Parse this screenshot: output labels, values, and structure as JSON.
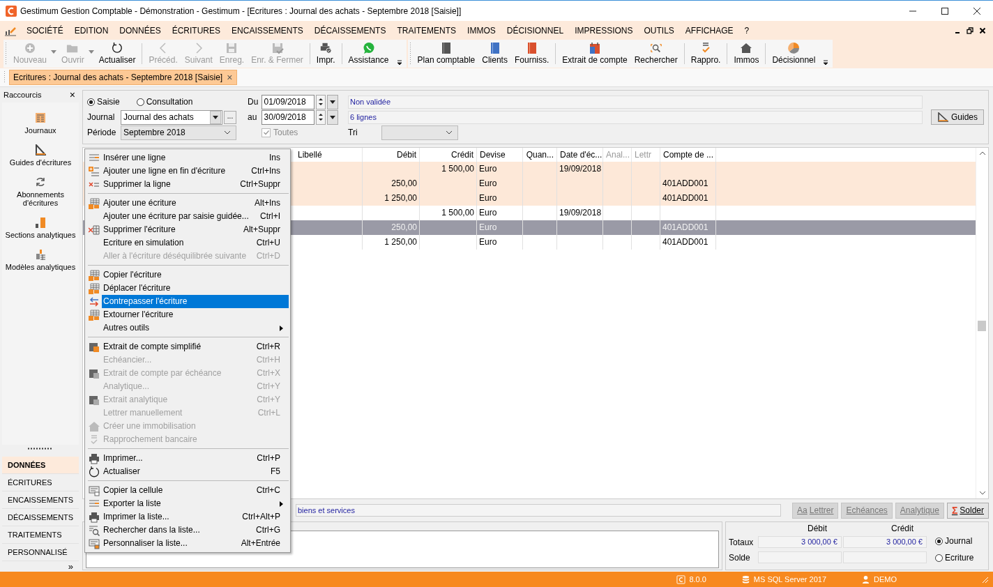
{
  "window": {
    "title": "Gestimum Gestion Comptable - Démonstration - Gestimum - [Ecritures : Journal des achats - Septembre 2018 [Saisie]]"
  },
  "menubar": {
    "items": [
      "SOCIÉTÉ",
      "EDITION",
      "DONNÉES",
      "ÉCRITURES",
      "ENCAISSEMENTS",
      "DÉCAISSEMENTS",
      "TRAITEMENTS",
      "IMMOS",
      "DÉCISIONNEL",
      "IMPRESSIONS",
      "OUTILS",
      "AFFICHAGE",
      "?"
    ]
  },
  "toolbars": [
    {
      "groups": [
        [
          {
            "label": "Nouveau",
            "disabled": true,
            "dropdown": true
          },
          {
            "label": "Ouvrir",
            "disabled": true,
            "dropdown": true
          },
          {
            "label": "Actualiser",
            "disabled": false,
            "dropdown": false
          }
        ],
        [
          {
            "label": "Précéd.",
            "disabled": true,
            "dropdown": false
          },
          {
            "label": "Suivant",
            "disabled": true,
            "dropdown": false
          },
          {
            "label": "Enreg.",
            "disabled": true,
            "dropdown": false
          },
          {
            "label": "Enr. & Fermer",
            "disabled": true,
            "dropdown": false
          }
        ],
        [
          {
            "label": "Impr.",
            "disabled": false,
            "dropdown": false
          }
        ],
        [
          {
            "label": "Assistance",
            "disabled": false,
            "dropdown": false
          }
        ]
      ]
    },
    {
      "groups": [
        [
          {
            "label": "Plan comptable",
            "disabled": false,
            "dropdown": false
          },
          {
            "label": "Clients",
            "disabled": false,
            "dropdown": false
          },
          {
            "label": "Fourniss.",
            "disabled": false,
            "dropdown": false
          }
        ],
        [
          {
            "label": "Extrait de compte",
            "disabled": false,
            "dropdown": false
          },
          {
            "label": "Rechercher",
            "disabled": false,
            "dropdown": false
          }
        ],
        [
          {
            "label": "Rappro.",
            "disabled": false,
            "dropdown": false
          }
        ],
        [
          {
            "label": "Immos",
            "disabled": false,
            "dropdown": false
          }
        ],
        [
          {
            "label": "Décisionnel",
            "disabled": false,
            "dropdown": false
          }
        ]
      ]
    }
  ],
  "document_tab": {
    "label": "Ecritures : Journal des achats - Septembre 2018 [Saisie]",
    "close": "×"
  },
  "sidebar": {
    "title": "Raccourcis",
    "close": "×",
    "shortcuts": [
      "Journaux",
      "Guides d'écritures",
      "Abonnements d'écritures",
      "Sections analytiques",
      "Modèles analytiques"
    ],
    "nav": [
      {
        "label": "DONNÉES",
        "selected": true
      },
      {
        "label": "ÉCRITURES",
        "selected": false
      },
      {
        "label": "ENCAISSEMENTS",
        "selected": false
      },
      {
        "label": "DÉCAISSEMENTS",
        "selected": false
      },
      {
        "label": "TRAITEMENTS",
        "selected": false
      },
      {
        "label": "PERSONNALISÉ",
        "selected": false
      }
    ],
    "more": "»"
  },
  "filter": {
    "modes": [
      {
        "label": "Saisie",
        "selected": true
      },
      {
        "label": "Consultation",
        "selected": false
      }
    ],
    "journal_label": "Journal",
    "journal": "Journal des achats",
    "journal_browse": "...",
    "periode_label": "Période",
    "periode": "Septembre 2018",
    "du_label": "Du",
    "du": "01/09/2018",
    "au_label": "au",
    "au": "30/09/2018",
    "toutes": {
      "label": "Toutes",
      "checked": true,
      "disabled": true
    },
    "status": "Non validée",
    "count": "6 lignes",
    "tri_label": "Tri",
    "guides": "Guides"
  },
  "table": {
    "columns": [
      "Libellé",
      "Débit",
      "Crédit",
      "Devise",
      "Quan...",
      "Date d'éc...",
      "Anal...",
      "Lettr",
      "Compte de ..."
    ],
    "rows": [
      {
        "current_entry": true,
        "selected": false,
        "cells": [
          "",
          "",
          "1 500,00",
          "Euro",
          "",
          "19/09/2018",
          "",
          "",
          ""
        ]
      },
      {
        "current_entry": true,
        "selected": false,
        "cells": [
          "",
          "250,00",
          "",
          "Euro",
          "",
          "",
          "",
          "",
          "401ADD001"
        ]
      },
      {
        "current_entry": true,
        "selected": false,
        "cells": [
          "",
          "1 250,00",
          "",
          "Euro",
          "",
          "",
          "",
          "",
          "401ADD001"
        ]
      },
      {
        "current_entry": false,
        "selected": false,
        "cells": [
          "",
          "",
          "1 500,00",
          "Euro",
          "",
          "19/09/2018",
          "",
          "",
          ""
        ]
      },
      {
        "current_entry": false,
        "selected": true,
        "cells": [
          "",
          "250,00",
          "",
          "Euro",
          "",
          "",
          "",
          "",
          "401ADD001"
        ]
      },
      {
        "current_entry": false,
        "selected": false,
        "cells": [
          "",
          "1 250,00",
          "",
          "Euro",
          "",
          "",
          "",
          "",
          "401ADD001"
        ]
      }
    ]
  },
  "context_menu": {
    "groups": [
      [
        {
          "label": "Insérer une ligne",
          "shortcut": "Ins",
          "disabled": false,
          "selected": false,
          "submenu": false
        },
        {
          "label": "Ajouter une ligne en fin d'écriture",
          "shortcut": "Ctrl+Ins",
          "disabled": false,
          "selected": false,
          "submenu": false
        },
        {
          "label": "Supprimer la ligne",
          "shortcut": "Ctrl+Suppr",
          "disabled": false,
          "selected": false,
          "submenu": false
        }
      ],
      [
        {
          "label": "Ajouter une écriture",
          "shortcut": "Alt+Ins",
          "disabled": false,
          "selected": false,
          "submenu": false
        },
        {
          "label": "Ajouter une écriture par saisie guidée...",
          "shortcut": "Ctrl+I",
          "disabled": false,
          "selected": false,
          "submenu": false
        },
        {
          "label": "Supprimer l'écriture",
          "shortcut": "Alt+Suppr",
          "disabled": false,
          "selected": false,
          "submenu": false
        },
        {
          "label": "Ecriture en simulation",
          "shortcut": "Ctrl+U",
          "disabled": false,
          "selected": false,
          "submenu": false
        },
        {
          "label": "Aller à l'écriture déséquilibrée suivante",
          "shortcut": "Ctrl+D",
          "disabled": true,
          "selected": false,
          "submenu": false
        }
      ],
      [
        {
          "label": "Copier l'écriture",
          "disabled": false,
          "selected": false,
          "submenu": false
        },
        {
          "label": "Déplacer l'écriture",
          "disabled": false,
          "selected": false,
          "submenu": false
        },
        {
          "label": "Contrepasser l'écriture",
          "disabled": false,
          "selected": true,
          "submenu": false
        },
        {
          "label": "Extourner l'écriture",
          "disabled": false,
          "selected": false,
          "submenu": false
        },
        {
          "label": "Autres outils",
          "disabled": false,
          "selected": false,
          "submenu": true
        }
      ],
      [
        {
          "label": "Extrait de compte simplifié",
          "shortcut": "Ctrl+R",
          "disabled": false,
          "selected": false,
          "submenu": false
        },
        {
          "label": "Echéancier...",
          "shortcut": "Ctrl+H",
          "disabled": true,
          "selected": false,
          "submenu": false
        },
        {
          "label": "Extrait de compte par échéance",
          "shortcut": "Ctrl+X",
          "disabled": true,
          "selected": false,
          "submenu": false
        },
        {
          "label": "Analytique...",
          "shortcut": "Ctrl+Y",
          "disabled": true,
          "selected": false,
          "submenu": false
        },
        {
          "label": "Extrait analytique",
          "shortcut": "Ctrl+Y",
          "disabled": true,
          "selected": false,
          "submenu": false
        },
        {
          "label": "Lettrer manuellement",
          "shortcut": "Ctrl+L",
          "disabled": true,
          "selected": false,
          "submenu": false
        },
        {
          "label": "Créer une immobilisation",
          "disabled": true,
          "selected": false,
          "submenu": false
        },
        {
          "label": "Rapprochement bancaire",
          "disabled": true,
          "selected": false,
          "submenu": false
        }
      ],
      [
        {
          "label": "Imprimer...",
          "shortcut": "Ctrl+P",
          "disabled": false,
          "selected": false,
          "submenu": false
        },
        {
          "label": "Actualiser",
          "shortcut": "F5",
          "disabled": false,
          "selected": false,
          "submenu": false
        }
      ],
      [
        {
          "label": "Copier la cellule",
          "shortcut": "Ctrl+C",
          "disabled": false,
          "selected": false,
          "submenu": false
        },
        {
          "label": "Exporter la liste",
          "disabled": false,
          "selected": false,
          "submenu": true
        },
        {
          "label": "Imprimer la liste...",
          "shortcut": "Ctrl+Alt+P",
          "disabled": false,
          "selected": false,
          "submenu": false
        },
        {
          "label": "Rechercher dans la liste...",
          "shortcut": "Ctrl+G",
          "disabled": false,
          "selected": false,
          "submenu": false
        },
        {
          "label": "Personnaliser la liste...",
          "shortcut": "Alt+Entrée",
          "disabled": false,
          "selected": false,
          "submenu": false
        }
      ]
    ]
  },
  "libelle_field": "biens et services",
  "actions": [
    {
      "label": "Lettrer",
      "prefix": "Aa",
      "disabled": true
    },
    {
      "label": "Echéances",
      "disabled": true
    },
    {
      "label": "Analytique",
      "disabled": true
    },
    {
      "label": "Solder",
      "prefix": "Σ",
      "disabled": false
    }
  ],
  "totals": {
    "columns": [
      "Débit",
      "Crédit"
    ],
    "rows": [
      {
        "label": "Totaux",
        "debit": "3 000,00 €",
        "credit": "3 000,00 €"
      },
      {
        "label": "Solde",
        "debit": "",
        "credit": ""
      }
    ],
    "scope": [
      {
        "label": "Journal",
        "selected": true
      },
      {
        "label": "Ecriture",
        "selected": false
      }
    ]
  },
  "status_bar": {
    "version": "8.0.0",
    "database": "MS SQL Server 2017",
    "user": "DEMO"
  }
}
